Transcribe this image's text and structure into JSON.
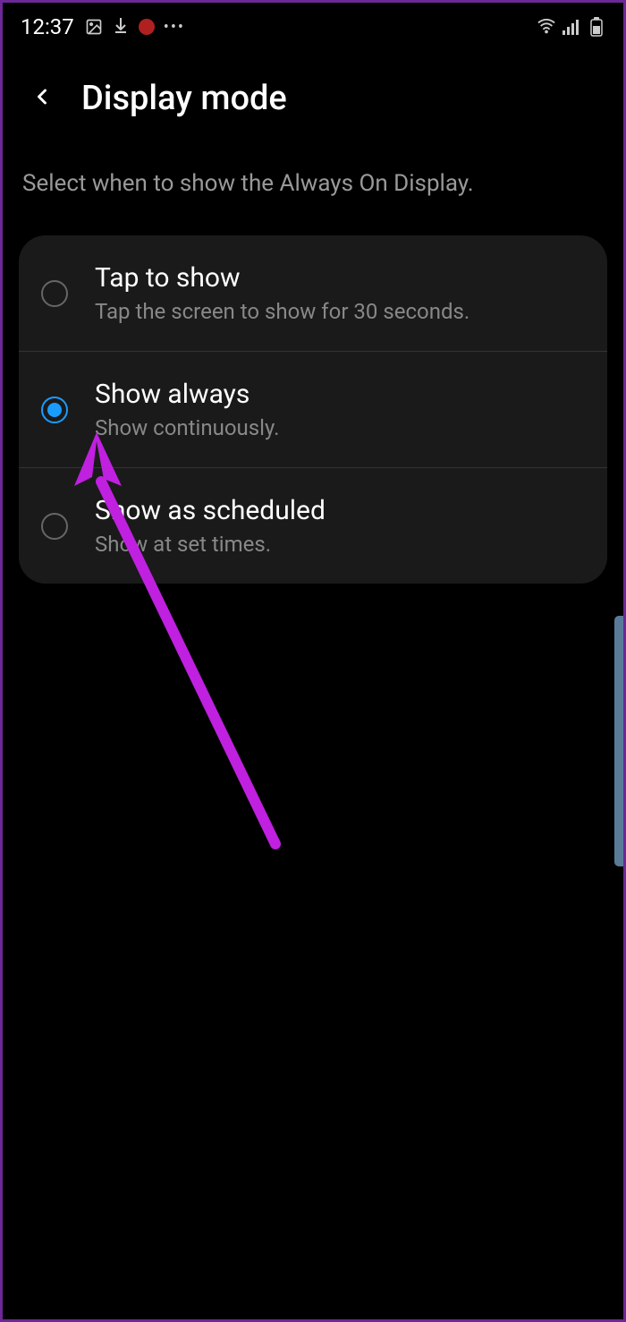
{
  "statusBar": {
    "time": "12:37"
  },
  "header": {
    "title": "Display mode"
  },
  "description": "Select when to show the Always On Display.",
  "options": [
    {
      "title": "Tap to show",
      "subtitle": "Tap the screen to show for 30 seconds.",
      "selected": false
    },
    {
      "title": "Show always",
      "subtitle": "Show continuously.",
      "selected": true
    },
    {
      "title": "Show as scheduled",
      "subtitle": "Show at set times.",
      "selected": false
    }
  ]
}
